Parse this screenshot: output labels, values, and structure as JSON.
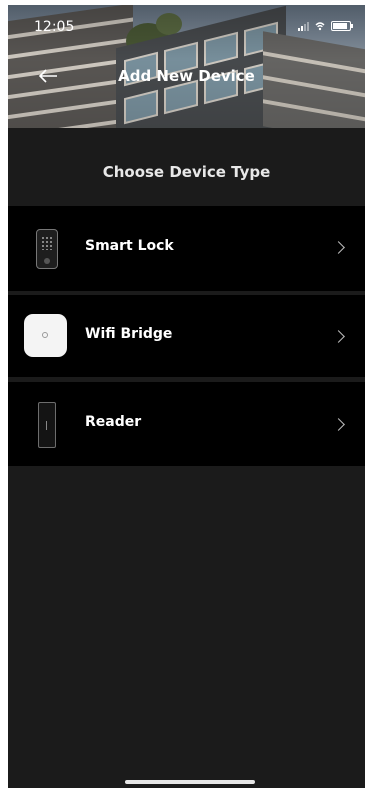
{
  "status_bar": {
    "time": "12:05"
  },
  "header": {
    "title": "Add New Device"
  },
  "section": {
    "title": "Choose Device Type"
  },
  "devices": [
    {
      "label": "Smart Lock",
      "icon": "smart-lock-icon"
    },
    {
      "label": "Wifi Bridge",
      "icon": "wifi-bridge-icon"
    },
    {
      "label": "Reader",
      "icon": "reader-icon"
    }
  ],
  "colors": {
    "background": "#1b1b1b",
    "row_background": "#000000",
    "text": "#ffffff"
  }
}
